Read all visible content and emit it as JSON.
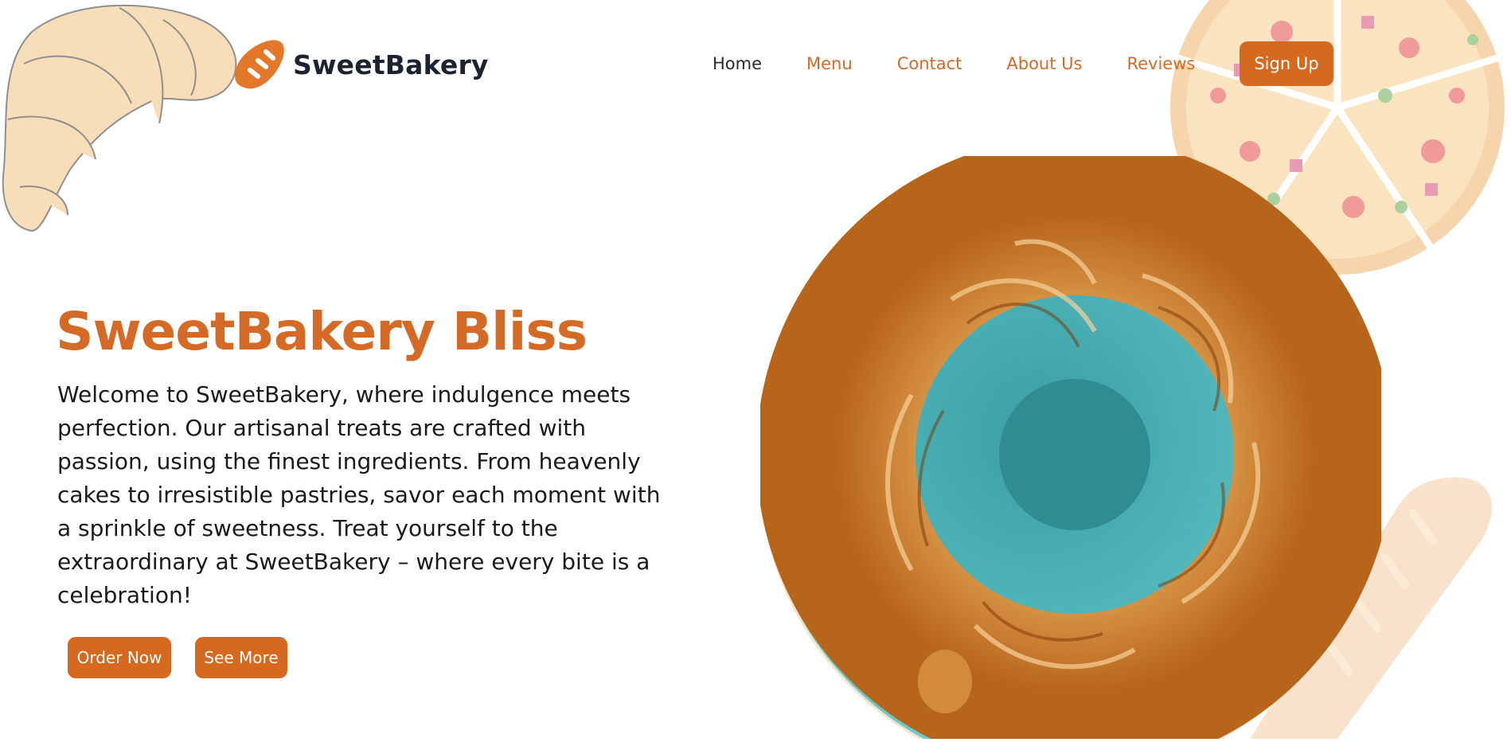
{
  "header": {
    "brand": "SweetBakery",
    "nav": [
      {
        "label": "Home",
        "active": true
      },
      {
        "label": "Menu"
      },
      {
        "label": "Contact"
      },
      {
        "label": "About Us"
      },
      {
        "label": "Reviews"
      }
    ],
    "signup_label": "Sign Up"
  },
  "hero": {
    "title": "SweetBakery Bliss",
    "text": "Welcome to SweetBakery, where indulgence meets perfection. Our artisanal treats are crafted with passion, using the finest ingredients. From heavenly cakes to irresistible pastries, savor each moment with a sprinkle of sweetness. Treat yourself to the extraordinary at SweetBakery – where every bite is a celebration!",
    "order_label": "Order Now",
    "more_label": "See More"
  },
  "colors": {
    "accent": "#d4691f",
    "title": "#d46a25",
    "plate": "#5fc2c6",
    "pastry": "#c8741f"
  },
  "icons": {
    "logo": "bread-loaf-icon",
    "decor_left": "croissant-illustration",
    "decor_top_right": "pizza-illustration",
    "decor_bottom_right": "baguette-illustration",
    "hero_image": "croissant-ring-on-plate"
  }
}
